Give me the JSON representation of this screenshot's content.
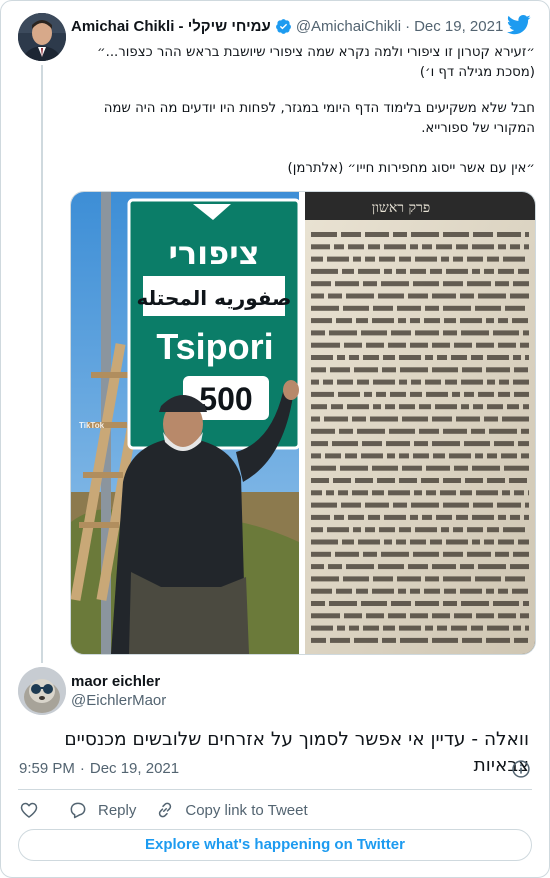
{
  "quoted_tweet": {
    "author_name": "Amichai Chikli - עמיחי שיקלי",
    "handle": "@AmichaiChikli",
    "separator": "·",
    "date": "Dec 19, 2021",
    "text_lines": [
      "״זעירא קטרון זו ציפורי ולמה נקרא שמה ציפורי שיושבת בראש ההר כצפור...״",
      "(מסכת מגילה דף ו׳)",
      "",
      "חבל שלא משקיעים בלימוד הדף היומי במגזר, לפחות היו יודעים מה היה שמה",
      "המקורי של ספורייא.",
      "",
      "״אין עם אשר ייסוג מחפירות חייו״ (אלתרמן)"
    ],
    "media": {
      "sign_hebrew": "ציפורי",
      "sign_arabic": "صفوريه المحتله",
      "sign_latin": "Tsipori",
      "sign_number": "500",
      "page_header": "פרק ראשון",
      "watermark": "TikTok"
    }
  },
  "reply": {
    "author_name": "maor eichler",
    "handle": "@EichlerMaor",
    "text": "וואלה - עדיין אי אפשר לסמוך על אזרחים שלובשים מכנסיים צבאיות",
    "time": "9:59 PM",
    "separator": "·",
    "date": "Dec 19, 2021"
  },
  "actions": {
    "reply_label": "Reply",
    "copy_link_label": "Copy link to Tweet"
  },
  "explore_label": "Explore what's happening on Twitter",
  "colors": {
    "brand": "#1d9bf0",
    "secondary_text": "#536471",
    "border": "#cfd9de",
    "sign_green": "#0b7d68"
  },
  "icons": [
    "verified-badge-icon",
    "twitter-bird-icon",
    "info-icon",
    "heart-icon",
    "reply-bubble-icon",
    "link-icon"
  ]
}
